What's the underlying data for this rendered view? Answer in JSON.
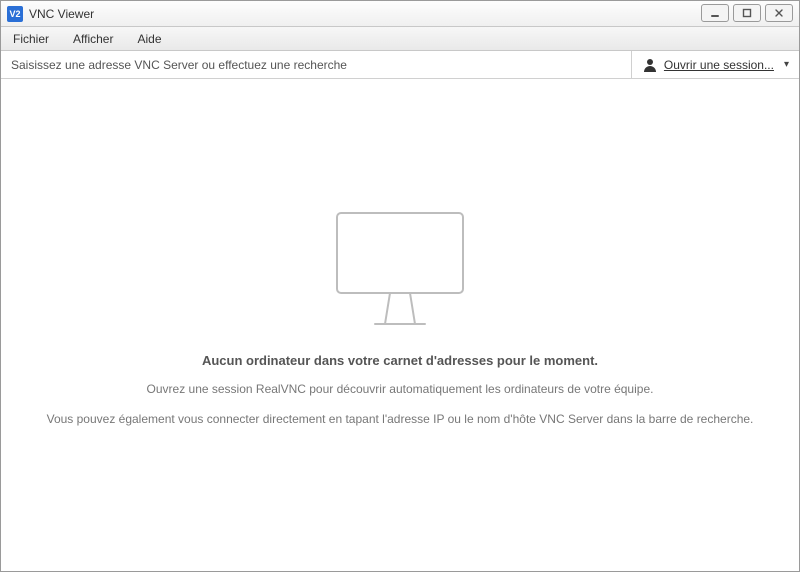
{
  "window": {
    "title": "VNC Viewer",
    "icon_text": "V2"
  },
  "menu": {
    "items": [
      "Fichier",
      "Afficher",
      "Aide"
    ]
  },
  "toolbar": {
    "search_placeholder": "Saisissez une adresse VNC Server ou effectuez une recherche",
    "session_label": "Ouvrir une session..."
  },
  "empty": {
    "title": "Aucun ordinateur dans votre carnet d'adresses pour le moment.",
    "line1": "Ouvrez une session RealVNC pour découvrir automatiquement les ordinateurs de votre équipe.",
    "line2": "Vous pouvez également vous connecter directement en tapant l'adresse IP ou le nom d'hôte VNC Server dans la barre de recherche."
  }
}
